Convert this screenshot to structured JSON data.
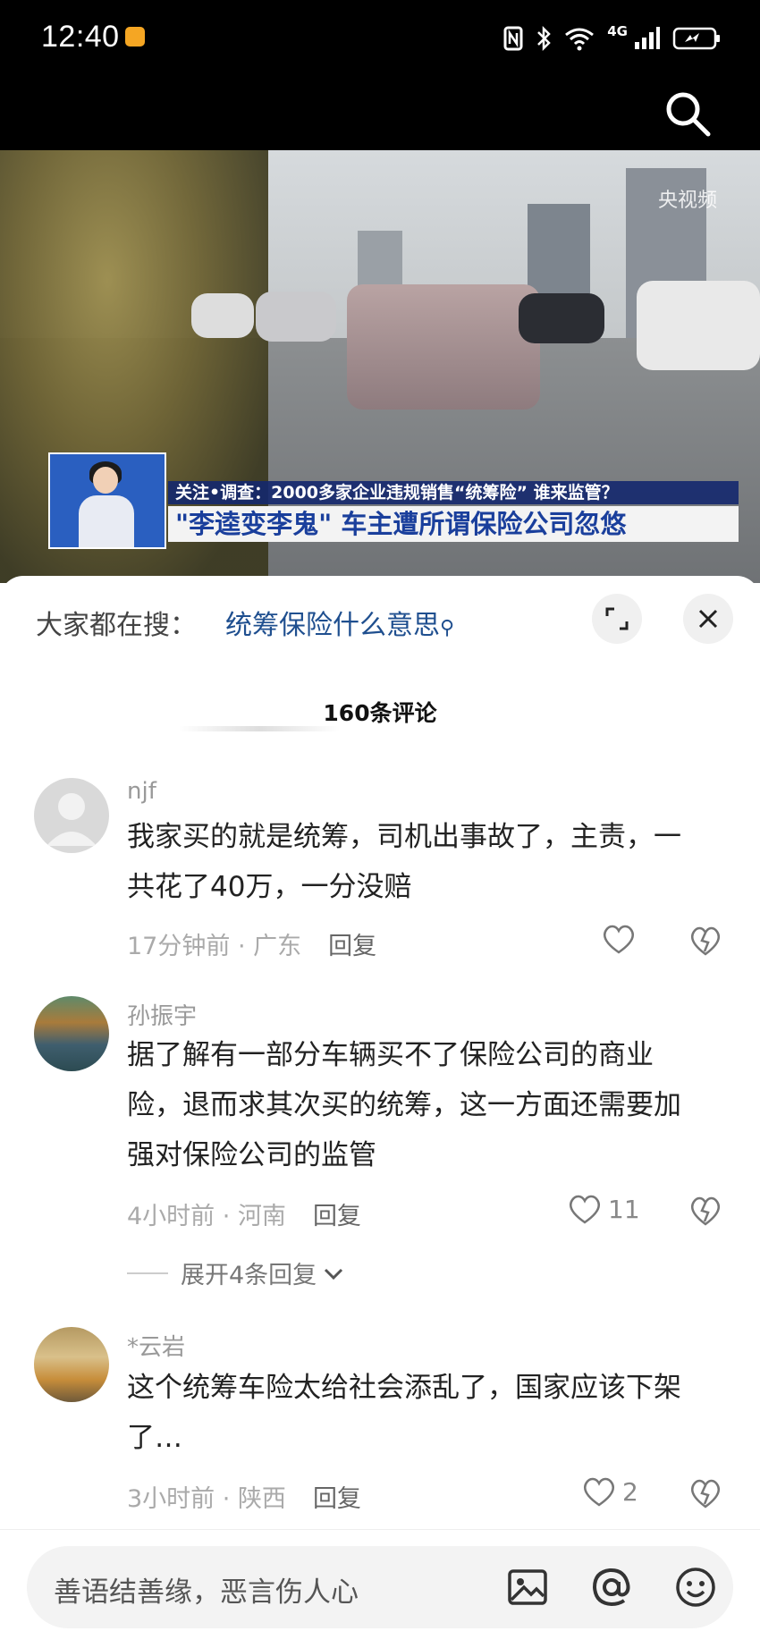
{
  "status_bar": {
    "time": "12:40",
    "network": "4G"
  },
  "video": {
    "watermark": "央视频",
    "banner_line1": "关注•调查：2000多家企业违规销售“统筹险” 谁来监管？",
    "banner_line2": "\"李逵变李鬼\" 车主遭所谓保险公司忽悠"
  },
  "sheet": {
    "hot_search_label": "大家都在搜：",
    "hot_search_term": "统筹保险什么意思",
    "comment_count": "160条评论"
  },
  "comments": [
    {
      "user": "njf",
      "text": "我家买的就是统筹，司机出事故了，主责，一共花了40万，一分没赔",
      "time": "17分钟前",
      "location": "广东",
      "reply_label": "回复",
      "likes": ""
    },
    {
      "user": "孙振宇",
      "text": "据了解有一部分车辆买不了保险公司的商业险，退而求其次买的统筹，这一方面还需要加强对保险公司的监管",
      "time": "4小时前",
      "location": "河南",
      "reply_label": "回复",
      "likes": "11",
      "expand_label": "展开4条回复"
    },
    {
      "user": "*云岩",
      "text": "这个统筹车险太给社会添乱了，国家应该下架了…",
      "time": "3小时前",
      "location": "陕西",
      "reply_label": "回复",
      "likes": "2"
    }
  ],
  "input": {
    "placeholder": "善语结善缘，恶言伤人心"
  }
}
